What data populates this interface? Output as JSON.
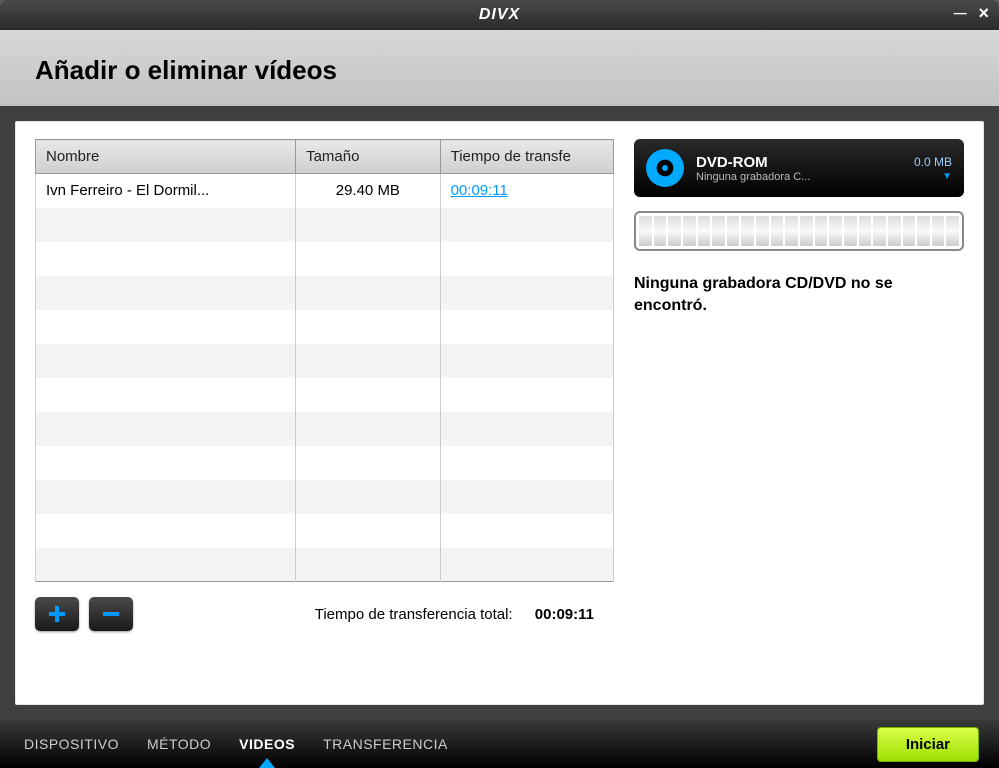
{
  "app": {
    "logo": "DIVX"
  },
  "header": {
    "title": "Añadir o eliminar vídeos"
  },
  "table": {
    "cols": {
      "name": "Nombre",
      "size": "Tamaño",
      "time": "Tiempo de transfe"
    },
    "rows": [
      {
        "name": "Ivn Ferreiro - El Dormil...",
        "size": "29.40 MB",
        "time": "00:09:11"
      }
    ]
  },
  "total": {
    "label": "Tiempo de transferencia total:",
    "value": "00:09:11"
  },
  "device": {
    "title": "DVD-ROM",
    "subtitle": "Ninguna grabadora C...",
    "size": "0.0 MB"
  },
  "status": {
    "message": "Ninguna grabadora CD/DVD no se encontró."
  },
  "tabs": {
    "dispositivo": "DISPOSITIVO",
    "metodo": "MÉTODO",
    "videos": "VIDEOS",
    "transferencia": "TRANSFERENCIA"
  },
  "buttons": {
    "start": "Iniciar"
  }
}
